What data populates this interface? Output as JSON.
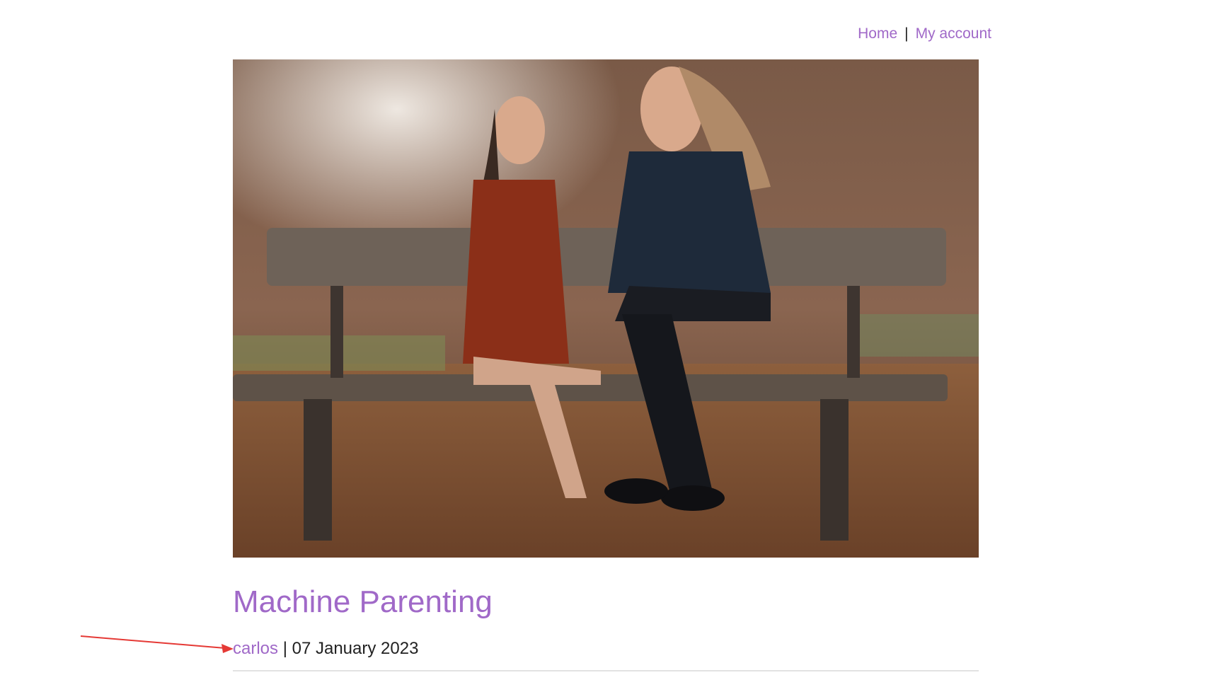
{
  "nav": {
    "home_label": "Home",
    "separator": "|",
    "account_label": "My account"
  },
  "post": {
    "image_alt": "Mother and daughter sitting on a park bench",
    "title": "Machine Parenting",
    "author": "carlos",
    "meta_separator": " | ",
    "date": "07 January 2023"
  },
  "colors": {
    "link": "#a069c8",
    "text": "#222222",
    "annotation_arrow": "#e53935"
  }
}
